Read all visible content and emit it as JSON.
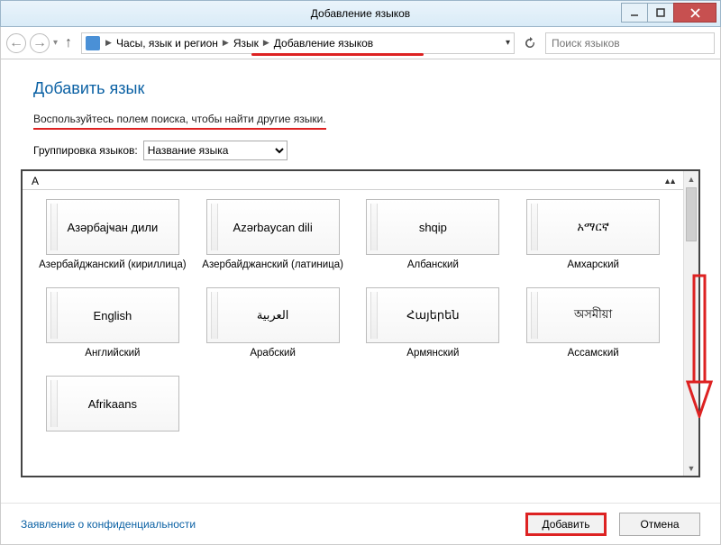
{
  "window": {
    "title": "Добавление языков"
  },
  "breadcrumb": {
    "root_icon": "control-panel-icon",
    "items": [
      "Часы, язык и регион",
      "Язык",
      "Добавление языков"
    ]
  },
  "search": {
    "placeholder": "Поиск языков"
  },
  "page": {
    "heading": "Добавить язык",
    "hint": "Воспользуйтесь полем поиска, чтобы найти другие языки.",
    "group_label": "Группировка языков:",
    "group_value": "Название языка"
  },
  "section": {
    "letter": "A"
  },
  "langs": [
    {
      "native": "Азәрбајҹан дили",
      "label": "Азербайджанский (кириллица)"
    },
    {
      "native": "Azərbaycan dili",
      "label": "Азербайджанский (латиница)"
    },
    {
      "native": "shqip",
      "label": "Албанский"
    },
    {
      "native": "አማርኛ",
      "label": "Амхарский"
    },
    {
      "native": "English",
      "label": "Английский"
    },
    {
      "native": "العربية",
      "label": "Арабский"
    },
    {
      "native": "Հայերեն",
      "label": "Армянский"
    },
    {
      "native": "অসমীয়া",
      "label": "Ассамский"
    },
    {
      "native": "Afrikaans",
      "label": ""
    }
  ],
  "footer": {
    "privacy": "Заявление о конфиденциальности",
    "add": "Добавить",
    "cancel": "Отмена"
  }
}
